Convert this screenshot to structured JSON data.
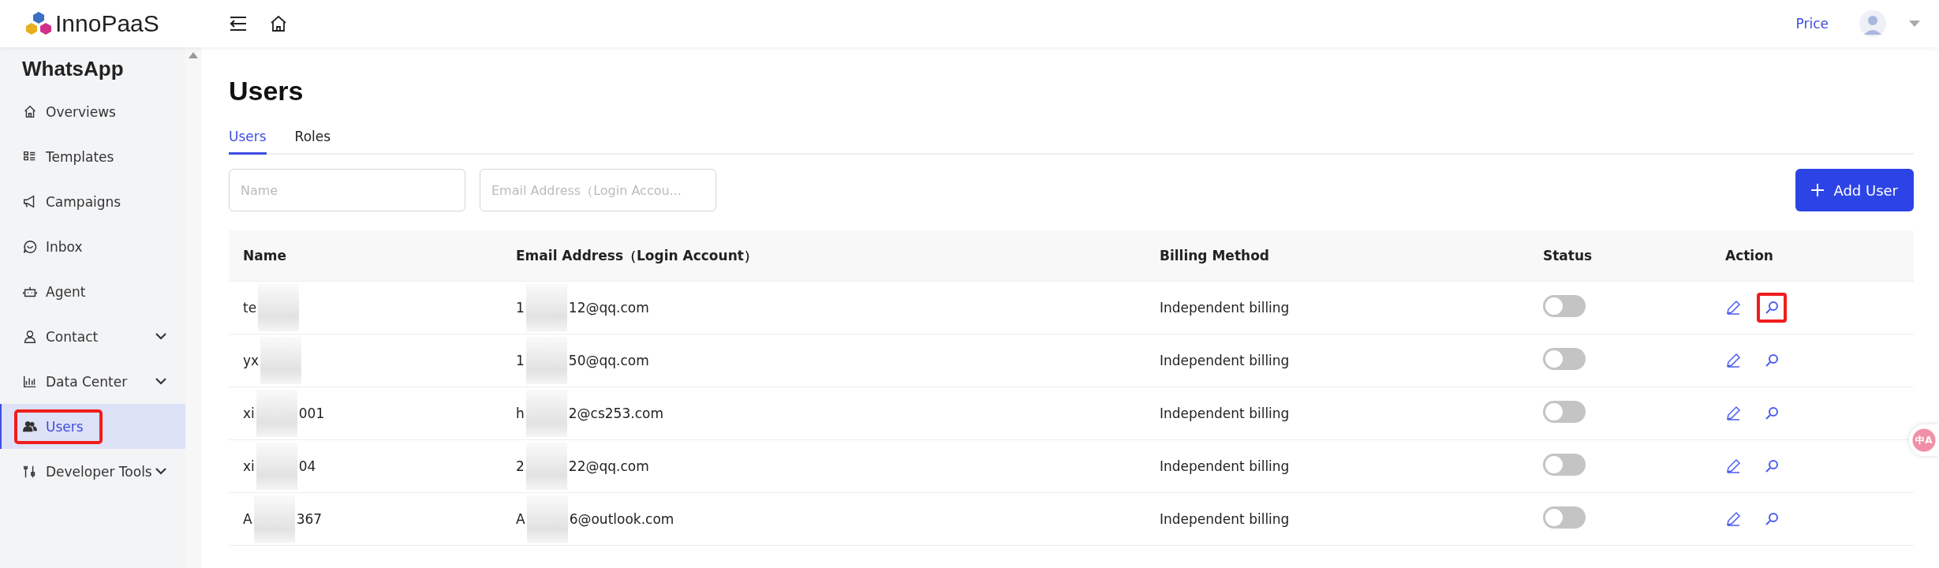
{
  "brand": {
    "name": "InnoPaaS"
  },
  "header": {
    "price_link": "Price"
  },
  "sidebar": {
    "title": "WhatsApp",
    "items": [
      {
        "label": "Overviews",
        "expandable": false,
        "selected": false,
        "highlighted": false
      },
      {
        "label": "Templates",
        "expandable": false,
        "selected": false,
        "highlighted": false
      },
      {
        "label": "Campaigns",
        "expandable": false,
        "selected": false,
        "highlighted": false
      },
      {
        "label": "Inbox",
        "expandable": false,
        "selected": false,
        "highlighted": false
      },
      {
        "label": "Agent",
        "expandable": false,
        "selected": false,
        "highlighted": false
      },
      {
        "label": "Contact",
        "expandable": true,
        "selected": false,
        "highlighted": false
      },
      {
        "label": "Data Center",
        "expandable": true,
        "selected": false,
        "highlighted": false
      },
      {
        "label": "Users",
        "expandable": false,
        "selected": true,
        "highlighted": true
      },
      {
        "label": "Developer Tools",
        "expandable": true,
        "selected": false,
        "highlighted": false
      }
    ]
  },
  "page": {
    "title": "Users",
    "tabs": [
      {
        "label": "Users",
        "selected": true
      },
      {
        "label": "Roles",
        "selected": false
      }
    ],
    "filters": [
      {
        "placeholder": "Name"
      },
      {
        "placeholder": "Email Address（Login Accou..."
      }
    ],
    "add_button": "Add User",
    "table": {
      "columns": [
        "Name",
        "Email Address（Login Account）",
        "Billing Method",
        "Status",
        "Action"
      ],
      "rows": [
        {
          "name_parts": [
            "te"
          ],
          "email_parts": [
            "1",
            "12@qq.com"
          ],
          "billing": "Independent billing",
          "on": false,
          "view_highlighted": true
        },
        {
          "name_parts": [
            "yx"
          ],
          "email_parts": [
            "1",
            "50@qq.com"
          ],
          "billing": "Independent billing",
          "on": false,
          "view_highlighted": false
        },
        {
          "name_parts": [
            "xi",
            "001"
          ],
          "email_parts": [
            "h",
            "2@cs253.com"
          ],
          "billing": "Independent billing",
          "on": false,
          "view_highlighted": false
        },
        {
          "name_parts": [
            "xi",
            "04"
          ],
          "email_parts": [
            "2",
            "22@qq.com"
          ],
          "billing": "Independent billing",
          "on": false,
          "view_highlighted": false
        },
        {
          "name_parts": [
            "A",
            "367"
          ],
          "email_parts": [
            "A",
            "6@outlook.com"
          ],
          "billing": "Independent billing",
          "on": false,
          "view_highlighted": false
        }
      ]
    }
  },
  "translate_badge": "中A"
}
